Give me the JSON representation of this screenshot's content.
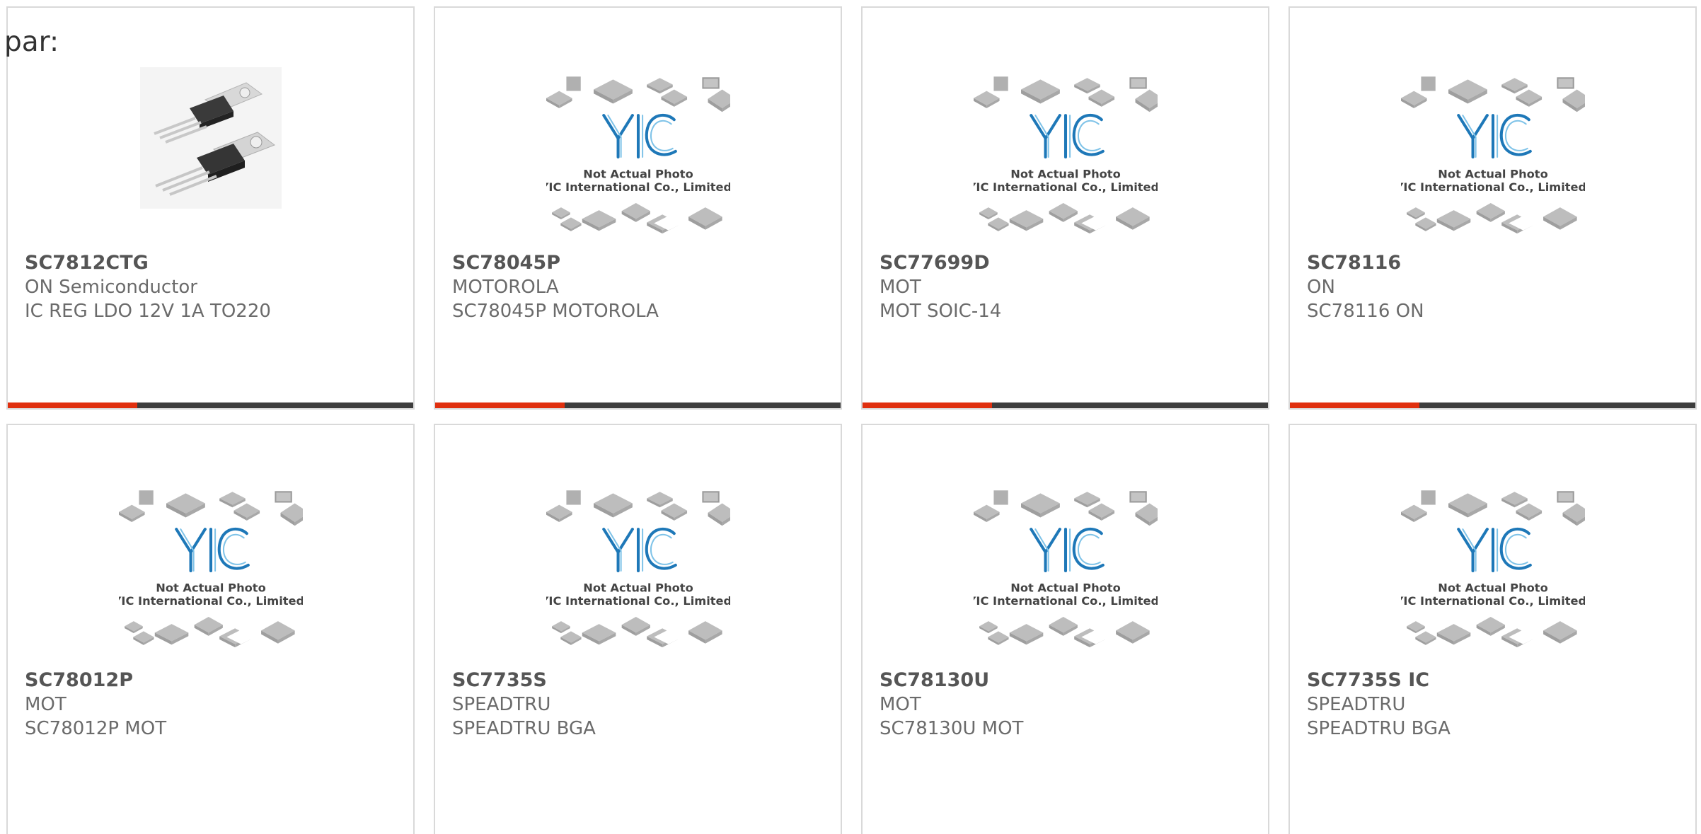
{
  "section_label": "par:",
  "accent_color": "#e0300f",
  "bar_color": "#3d3d3d",
  "placeholder": {
    "brand": "YIC",
    "line1": "Not Actual Photo",
    "line2": "YIC International Co., Limited."
  },
  "products": [
    {
      "part": "SC7812CTG",
      "manufacturer": "ON Semiconductor",
      "description": "IC REG LDO 12V 1A TO220",
      "image": "to220-photo"
    },
    {
      "part": "SC78045P",
      "manufacturer": "MOTOROLA",
      "description": "SC78045P MOTOROLA",
      "image": "placeholder"
    },
    {
      "part": "SC77699D",
      "manufacturer": "MOT",
      "description": "MOT SOIC-14",
      "image": "placeholder"
    },
    {
      "part": "SC78116",
      "manufacturer": "ON",
      "description": "SC78116 ON",
      "image": "placeholder"
    },
    {
      "part": "SC78012P",
      "manufacturer": "MOT",
      "description": "SC78012P MOT",
      "image": "placeholder"
    },
    {
      "part": "SC7735S",
      "manufacturer": "SPEADTRU",
      "description": "SPEADTRU BGA",
      "image": "placeholder"
    },
    {
      "part": "SC78130U",
      "manufacturer": "MOT",
      "description": "SC78130U MOT",
      "image": "placeholder"
    },
    {
      "part": "SC7735S IC",
      "manufacturer": "SPEADTRU",
      "description": "SPEADTRU BGA",
      "image": "placeholder"
    }
  ]
}
